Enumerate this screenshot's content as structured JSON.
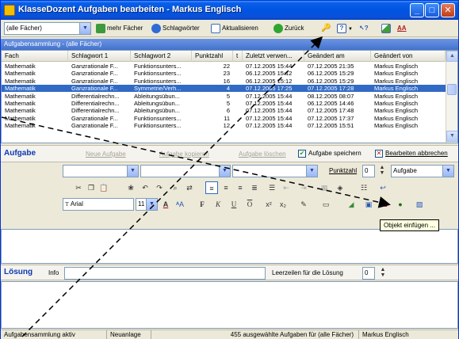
{
  "window": {
    "title": "KlasseDozent Aufgaben bearbeiten - Markus Englisch",
    "minimize": "_",
    "maximize": "□",
    "close": "✕"
  },
  "toolbar": {
    "subject_filter": "(alle Fächer)",
    "more_subjects": "mehr Fächer",
    "keywords": "Schlagwörter",
    "refresh": "Aktualisieren",
    "back": "Zurück"
  },
  "collection": {
    "header": "Aufgabensammlung - (alle Fächer)",
    "columns": [
      "Fach",
      "Schlagwort 1",
      "Schlagwort 2",
      "Punktzahl",
      "t",
      "Zuletzt verwen...",
      "Geändert am",
      "Geändert von"
    ],
    "rows": [
      [
        "Mathematik",
        "Ganzrationale F...",
        "Funktionsunters...",
        "22",
        "",
        "07.12.2005 15:44",
        "07.12.2005 21:35",
        "Markus Englisch"
      ],
      [
        "Mathematik",
        "Ganzrationale F...",
        "Funktionsunters...",
        "23",
        "",
        "06.12.2005 15:12",
        "06.12.2005 15:29",
        "Markus Englisch"
      ],
      [
        "Mathematik",
        "Ganzrationale F...",
        "Funktionsunters...",
        "16",
        "",
        "06.12.2005 15:12",
        "06.12.2005 15:29",
        "Markus Englisch"
      ],
      [
        "Mathematik",
        "Ganzrationale F...",
        "Symmetrie/Verh...",
        "4",
        "",
        "07.12.2005 17:25",
        "07.12.2005 17:28",
        "Markus Englisch"
      ],
      [
        "Mathematik",
        "Differentialrechn...",
        "Ableitungsübun...",
        "5",
        "",
        "07.12.2005 15:44",
        "08.12.2005 08:07",
        "Markus Englisch"
      ],
      [
        "Mathematik",
        "Differentialrechn...",
        "Ableitungsübun...",
        "5",
        "",
        "07.12.2005 15:44",
        "06.12.2005 14:46",
        "Markus Englisch"
      ],
      [
        "Mathematik",
        "Differentialrechn...",
        "Ableitungsübun...",
        "6",
        "",
        "07.12.2005 15:44",
        "07.12.2005 17:48",
        "Markus Englisch"
      ],
      [
        "Mathematik",
        "Ganzrationale F...",
        "Funktionsunters...",
        "11",
        "",
        "07.12.2005 15:44",
        "07.12.2005 17:37",
        "Markus Englisch"
      ],
      [
        "Mathematik",
        "Ganzrationale F...",
        "Funktionsunters...",
        "12",
        "",
        "07.12.2005 15:44",
        "07.12.2005 15:51",
        "Markus Englisch"
      ]
    ],
    "selected_row": 3
  },
  "task": {
    "title": "Aufgabe",
    "new_task": "Neue Aufgabe",
    "copy_task": "Aufgabe kopieren",
    "delete_task": "Aufgabe löschen",
    "save_task": "Aufgabe speichern",
    "cancel_edit": "Bearbeiten abbrechen",
    "points_label": "Punktzahl",
    "points_value": "0",
    "type_value": "Aufgabe",
    "font_name": "Arial",
    "font_size": "11",
    "tooltip": "Objekt einfügen ..."
  },
  "solution": {
    "title": "Lösung",
    "info": "Info",
    "blank_lines_label": "Leerzeilen für die Lösung",
    "blank_lines_value": "0"
  },
  "status": {
    "mode": "Aufgabensammlung aktiv",
    "state": "Neuanlage",
    "count": "455 ausgewählte Aufgaben für (alle Fächer)",
    "user": "Markus Englisch"
  },
  "colors": {
    "title_blue": "#0054e3",
    "selection": "#316ac5",
    "section_title": "#0d39b0"
  }
}
